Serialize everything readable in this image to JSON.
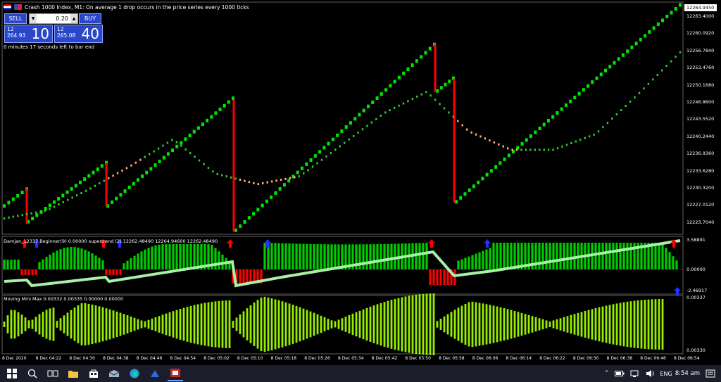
{
  "header": {
    "title": "Crash 1000 Index, M1:  On average 1 drop occurs in the price series every 1000 ticks"
  },
  "trade_panel": {
    "sell_label": "SELL",
    "buy_label": "BUY",
    "lot_value": "0.20",
    "sell_price_small_top": "12",
    "sell_price_small_bottom": "264.93",
    "sell_price_big": "10",
    "buy_price_small_top": "12",
    "buy_price_small_bottom": "265.08",
    "buy_price_big": "40"
  },
  "timer_text": "0 minutes 17 seconds left to bar end",
  "price_axis": {
    "current_price": "12264.9450",
    "labels": [
      "12263.4000",
      "12260.0920",
      "12256.7840",
      "12253.4760",
      "12250.1680",
      "12246.8600",
      "12243.5520",
      "12240.2440",
      "12236.9360",
      "12233.6280",
      "12230.3200",
      "12227.0120",
      "12223.7040"
    ]
  },
  "indicator1": {
    "label": "Damjan_12337 Beginner(9) 0.00000 supertrend (2) 12262.48490 12264.94600 12262.48490",
    "axis_labels": [
      "3.58891",
      "0.00000",
      "-2.46917"
    ]
  },
  "indicator2": {
    "label": "Moving Mini Max 0.00332 0.00335 0.00000 0.00000",
    "axis_labels": [
      "0.00337",
      "0.00330"
    ]
  },
  "time_axis": [
    "8 Dec 2020",
    "8 Dec 04:22",
    "8 Dec 04:30",
    "8 Dec 04:38",
    "8 Dec 04:46",
    "8 Dec 04:54",
    "8 Dec 05:02",
    "8 Dec 05:10",
    "8 Dec 05:18",
    "8 Dec 05:26",
    "8 Dec 05:34",
    "8 Dec 05:42",
    "8 Dec 05:50",
    "8 Dec 05:58",
    "8 Dec 06:06",
    "8 Dec 06:14",
    "8 Dec 06:22",
    "8 Dec 06:30",
    "8 Dec 06:38",
    "8 Dec 06:46",
    "8 Dec 06:54"
  ],
  "taskbar": {
    "clock": "8:54 am",
    "language": "ENG",
    "icons": [
      "windows-start-icon",
      "search-icon",
      "task-view-icon",
      "file-explorer-icon",
      "store-icon",
      "mail-icon",
      "edge-icon",
      "trader-app-icon",
      "terminal-icon"
    ]
  },
  "colors": {
    "bull": "#00e600",
    "bear": "#ff0000",
    "ma": "#ffb080",
    "histogram_up": "#00cc00",
    "histogram_down": "#ff0000",
    "mini_max": "#99ee00",
    "supertrend_line": "#a8f0a8"
  },
  "chart_data": {
    "type": "candlestick",
    "instrument": "Crash 1000 Index, M1",
    "ylim": [
      12221.5,
      12265.5
    ],
    "current_price": 12264.945,
    "crash_candles": [
      {
        "time": "8 Dec 04:22",
        "from": 12230.2,
        "to": 12223.5
      },
      {
        "time": "8 Dec 04:38",
        "from": 12235.0,
        "to": 12226.8
      },
      {
        "time": "8 Dec 05:02",
        "from": 12247.0,
        "to": 12222.0
      },
      {
        "time": "8 Dec 05:50",
        "from": 12257.5,
        "to": 12248.5
      },
      {
        "time": "8 Dec 05:58",
        "from": 12251.0,
        "to": 12227.5
      }
    ],
    "moving_average_approx": [
      12224.5,
      12226.0,
      12230.0,
      12234.5,
      12239.5,
      12233.0,
      12231.0,
      12232.5,
      12238.5,
      12244.5,
      12248.5,
      12241.0,
      12237.5,
      12237.5,
      12240.5,
      12248.0,
      12256.0
    ]
  }
}
